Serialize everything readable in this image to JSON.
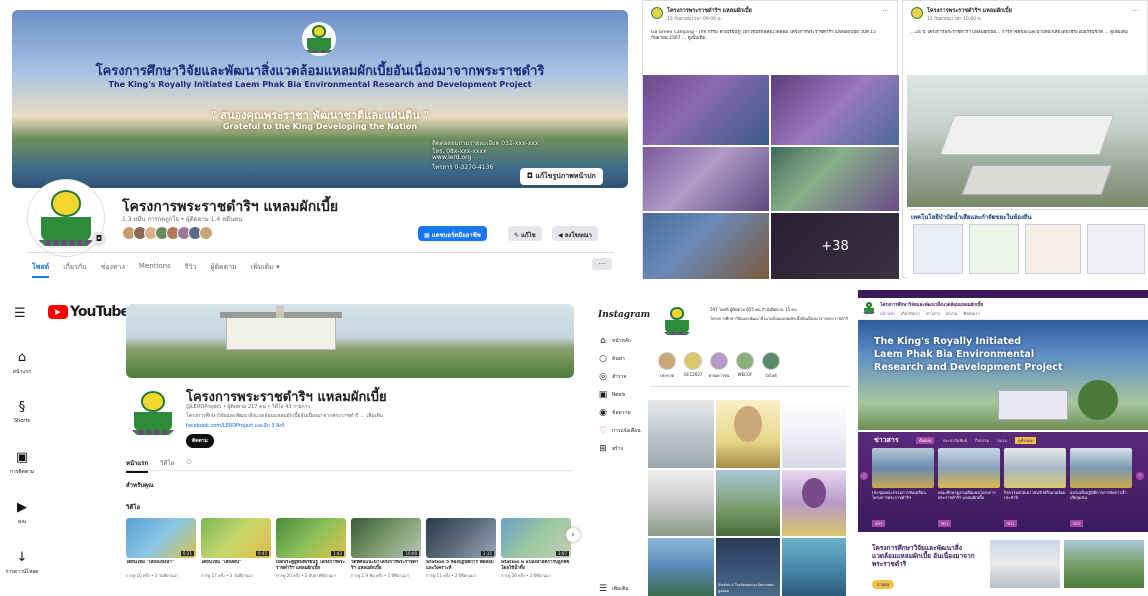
{
  "facebook": {
    "cover_title_th": "โครงการศึกษาวิจัยและพัฒนาสิ่งแวดล้อมแหลมผักเบี้ยอันเนื่องมาจากพระราชดำริ",
    "cover_title_en": "The King's Royally Initiated Laem Phak Bia Environmental Research and Development Project",
    "cover_slogan_th": "\" สนองคุณพระราชา พัฒนาชาติและแผ่นดิน \"",
    "cover_slogan_en": "Grateful to the King Developing the Nation",
    "cover_info": [
      "ติดต่อสอบถามรายละเอียด 032-xxx-xxx",
      "โทร. 08x-xxx-xxxx",
      "www.lerd.org",
      "โทรสาร 0-3270-4136"
    ],
    "edit_cover": "แก้ไขรูปภาพหน้าปก",
    "page_name": "โครงการพระราชดำริฯ แหลมผักเบี้ย",
    "page_stats": "1.3 หมื่น การกดถูกใจ • ผู้ติดตาม 1.4 หมื่นคน",
    "btn_dashboard": "แดชบอร์ดมืออาชีพ",
    "btn_edit": "แก้ไข",
    "btn_ads": "ลงโฆษณา",
    "tabs": [
      "โพสต์",
      "เกี่ยวกับ",
      "ช่องทาง",
      "Mentions",
      "รีวิว",
      "ผู้ติดตาม",
      "เพิ่มเติม ▾"
    ],
    "more_label": "···",
    "post1": {
      "name": "โครงการพระราชดำริฯ แหลมผักเบี้ย",
      "meta": "15 กันยายน เวลา 09:00 น.",
      "text": "Go Green Camping – [กิจ กรรม ค่ายเรียนรู้] เยาวชนรักษ์สิ่งแวดล้อม โครงการพระราชดำริฯ แหลมผักเบี้ย วันที่ 15 กันยายน 2567 ... ดูเพิ่มเติม",
      "more_count": "+38"
    },
    "post2": {
      "name": "โครงการพระราชดำริฯ แหลมผักเบี้ย",
      "meta": "11 กันยายน เวลา 10:00 น.",
      "text": "...24 ปี โครงการพระราชดำริฯ แหลมผักเบี้ย... การกำจัดขยะและบำบัดน้ำเสียโดยใช้ระบบธรรมชาติ ... ดูเพิ่มเติม",
      "banner": "เทคโนโลยีบำบัดน้ำเสียและกำจัดขยะในท้องถิ่น"
    }
  },
  "youtube": {
    "logo_text": "YouTube",
    "logo_tm": "TH",
    "menu_icon": "menu-icon",
    "nav": [
      "หน้าแรก",
      "Shorts",
      "การติดตาม",
      "คุณ",
      "การดาวน์โหลด"
    ],
    "channel_name": "โครงการพระราชดำริฯ แหลมผักเบี้ย",
    "handle": "@LERDProject • ผู้ติดตาม 217 คน • วิดีโอ 43 รายการ",
    "description": "โครงการศึกษาวิจัยและพัฒนาสิ่งแวดล้อมแหลมผักเบี้ยอันเนื่องมาจากพระราชดำริ ... เพิ่มเติม",
    "link": "facebook.com/LERDProject และอีก 3 ลิงก์",
    "subscribe": "ติดตาม",
    "tabs": [
      "หน้าแรก",
      "วิดีโอ"
    ],
    "section_for_you": "สำหรับคุณ",
    "section_videos": "วิดีโอ",
    "videos": [
      {
        "title": "ได้ยินไหม \"เสียงแห่งน้ำ\"",
        "meta": "การดู 10 ครั้ง • 3 วันที่ผ่านมา",
        "dur": "0:21"
      },
      {
        "title": "ได้ยินไหม \"เสียงดิน\"",
        "meta": "การดู 17 ครั้ง • 3 วันที่ผ่านมา",
        "dur": "0:45"
      },
      {
        "title": "เปิดประตูสู่พื้นที่เรียนรู้ โครงการพระราชดำริฯ แหลมผักเบี้ย",
        "meta": "การดู 20 ครั้ง • 2 สัปดาห์ที่ผ่านมา",
        "dur": "1:43"
      },
      {
        "title": "วีดิทัศน์แนะนำโครงการพระราชดำริฯ แหลมผักเบี้ย",
        "meta": "การดู 1.9 พัน ครั้ง • 1 ปีที่ผ่านมา",
        "dur": "10:00"
      },
      {
        "title": "Station 5 ห้องปฏิบัติการ ทดสอบและวิเคราะห์",
        "meta": "การดู 11 ครั้ง • 2 ปีที่ผ่านมา",
        "dur": "2:35"
      },
      {
        "title": "Station 6 แปลงสาธิตการปลูกพืชโดยใช้น้ำทิ้ง",
        "meta": "การดู 26 ครั้ง • 2 ปีที่ผ่านมา",
        "dur": "2:07"
      }
    ]
  },
  "instagram": {
    "logo": "Instagram",
    "nav": [
      "หน้าหลัก",
      "ค้นหา",
      "สำรวจ",
      "Reels",
      "ข้อความ",
      "การแจ้งเตือน",
      "สร้าง"
    ],
    "more": "เพิ่มเติม",
    "profile_stats": "597 โพสต์   ผู้ติดตาม 655 คน   กำลังติดตาม 15 คน",
    "profile_bio": "โครงการศึกษาวิจัยและพัฒนาสิ่งแวดล้อมแหลมผักเบี้ยอันเนื่องมาจากพระราชดำริ",
    "highlights": [
      "ประกวด",
      "GCC2027",
      "ค่ายเยาวชน",
      "WECOF",
      "ไฮไลต์"
    ],
    "post_caption": "Station 4 โรงคัดแยกและจัดการขยะมูลฝอย"
  },
  "website": {
    "brand": "โครงการศึกษาวิจัยและพัฒนาสิ่งแวดล้อมแหลมผักเบี้ย",
    "menu": [
      "หน้าแรก",
      "เกี่ยวกับเรา",
      "ข่าวสาร",
      "ผลงาน",
      "ติดต่อเรา"
    ],
    "hero_lines": [
      "The King's Royally Initiated",
      "Laem Phak Bia Environmental",
      "Research and Development Project"
    ],
    "news_title": "ข่าวสาร",
    "news_tabs": [
      "ทั้งหมด",
      "ประชาสัมพันธ์",
      "กิจกรรม",
      "อบรม",
      "ดูทั้งหมด"
    ],
    "news": [
      {
        "cap": "ประชุมคณะกรรมการขับเคลื่อนโครงการพระราชดำริฯ",
        "tag": "ข่าว"
      },
      {
        "cap": "คณะศึกษาดูงานเยี่ยมชมโครงการพระราชดำริฯ แหลมผักเบี้ย",
        "tag": "ข่าว"
      },
      {
        "cap": "กิจกรรมค่ายเยาวชนรักษ์สิ่งแวดล้อม ประจำปี",
        "tag": "ข่าว"
      },
      {
        "cap": "อบรมเชิงปฏิบัติการการจัดการน้ำเสียชุมชน",
        "tag": "ข่าว"
      }
    ],
    "bottom_title": "โครงการศึกษาวิจัยและพัฒนาสิ่งแวดล้อมแหลมผักเบี้ย อันเนื่องมาจากพระราชดำริ",
    "bottom_button": "อ่านต่อ"
  }
}
